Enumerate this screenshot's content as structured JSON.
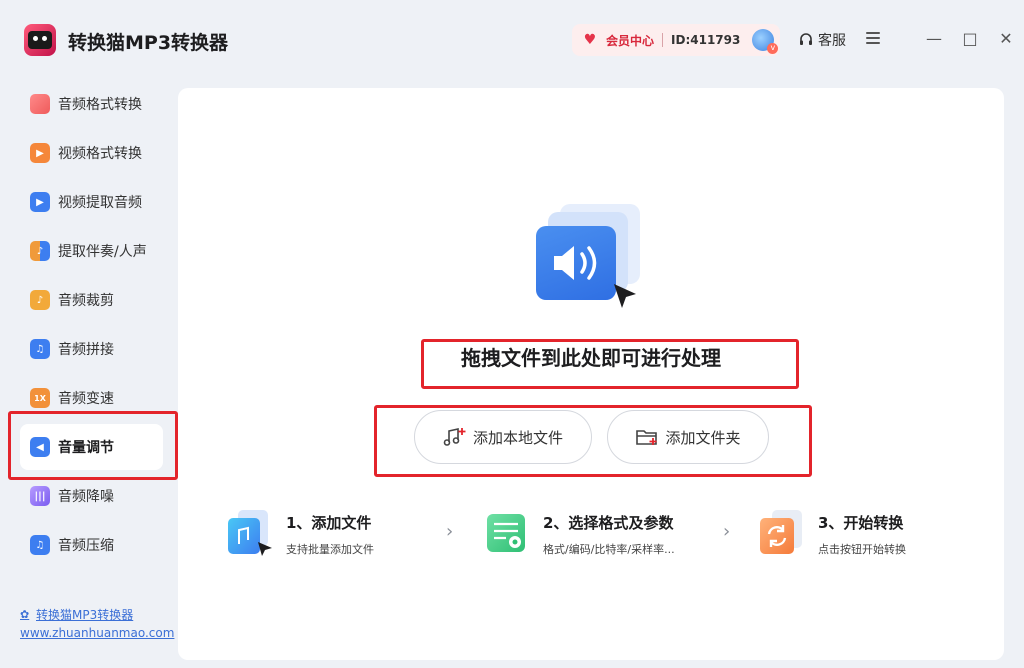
{
  "app": {
    "title": "转换猫MP3转换器"
  },
  "header": {
    "vip_label": "会员中心",
    "user_id": "ID:411793",
    "service_label": "客服"
  },
  "window_controls": {
    "minimize": "—",
    "maximize": "□",
    "close": "✕"
  },
  "sidebar": {
    "items": [
      {
        "label": "音频格式转换",
        "icon": "audio-format-icon",
        "color": "#ef5b5b"
      },
      {
        "label": "视频格式转换",
        "icon": "video-format-icon",
        "color": "#f5873a"
      },
      {
        "label": "视频提取音频",
        "icon": "video-extract-audio-icon",
        "color": "#3d7ef0"
      },
      {
        "label": "提取伴奏/人声",
        "icon": "vocal-extract-icon",
        "color": "#f09a3a"
      },
      {
        "label": "音频裁剪",
        "icon": "audio-cut-icon",
        "color": "#f2a93a"
      },
      {
        "label": "音频拼接",
        "icon": "audio-merge-icon",
        "color": "#3d7ef0"
      },
      {
        "label": "音频变速",
        "icon": "audio-speed-icon",
        "color": "#f2913a",
        "glyph": "1X"
      },
      {
        "label": "音量调节",
        "icon": "volume-adjust-icon",
        "color": "#3d7ef0",
        "active": true
      },
      {
        "label": "音频降噪",
        "icon": "noise-reduce-icon",
        "color": "#8b6cf0"
      },
      {
        "label": "音频压缩",
        "icon": "audio-compress-icon",
        "color": "#3d7ef0"
      }
    ],
    "footer_link": "转换猫MP3转换器",
    "footer_url": "www.zhuanhuanmao.com"
  },
  "main": {
    "drop_text": "拖拽文件到此处即可进行处理",
    "add_local_file": "添加本地文件",
    "add_folder": "添加文件夹",
    "steps": [
      {
        "title": "1、添加文件",
        "desc": "支持批量添加文件"
      },
      {
        "title": "2、选择格式及参数",
        "desc": "格式/编码/比特率/采样率..."
      },
      {
        "title": "3、开始转换",
        "desc": "点击按钮开始转换"
      }
    ]
  },
  "colors": {
    "accent": "#3d7ef0",
    "highlight_box": "#e3242b",
    "vip": "#d8283c"
  }
}
